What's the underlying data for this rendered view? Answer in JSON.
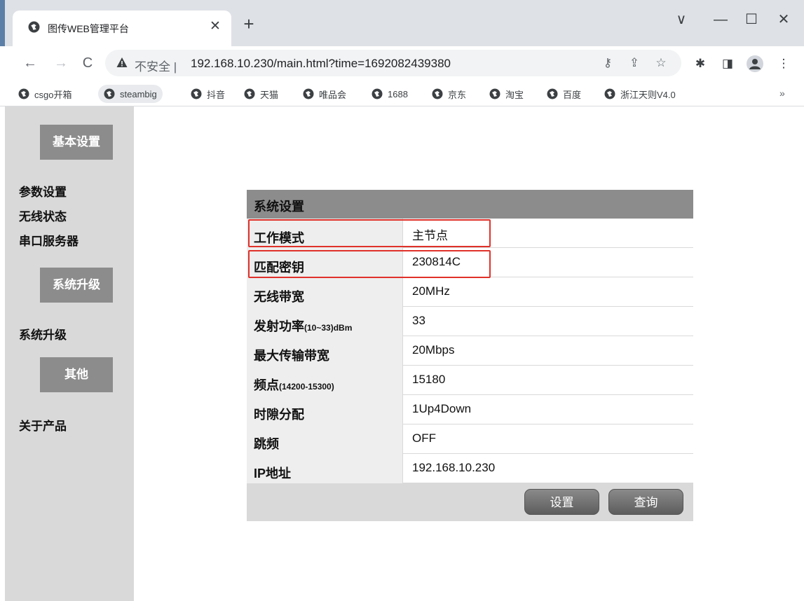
{
  "browser": {
    "tab_title": "图传WEB管理平台",
    "tab_close": "✕",
    "new_tab": "+",
    "window_minimize": "—",
    "window_maximize": "☐",
    "window_close": "✕",
    "window_menu": "∨",
    "back": "←",
    "forward": "→",
    "reload": "C",
    "insecure_label": "不安全 |",
    "url": "192.168.10.230/main.html?time=1692082439380",
    "bookmarks": [
      "csgo开箱",
      "steambig",
      "抖音",
      "天猫",
      "唯品会",
      "1688",
      "京东",
      "淘宝",
      "百度",
      "浙江天则V4.0"
    ],
    "bookmarks_more": "»",
    "icons": [
      "globe-icon",
      "key-icon",
      "share-icon",
      "star-icon",
      "extensions-icon",
      "side-panel-icon",
      "profile-icon",
      "menu-icon",
      "warning-icon"
    ]
  },
  "sidebar": {
    "sections": [
      {
        "title": "基本设置",
        "links": [
          "参数设置",
          "无线状态",
          "串口服务器"
        ]
      },
      {
        "title": "系统升级",
        "links": [
          "系统升级"
        ]
      },
      {
        "title": "其他",
        "links": [
          "关于产品"
        ]
      }
    ]
  },
  "panel": {
    "title": "系统设置",
    "rows": [
      {
        "label": "工作模式",
        "hint": "",
        "value": "主节点"
      },
      {
        "label": "匹配密钥",
        "hint": "",
        "value": "230814C"
      },
      {
        "label": "无线带宽",
        "hint": "",
        "value": "20MHz"
      },
      {
        "label": "发射功率",
        "hint": "(10~33)dBm",
        "value": "33"
      },
      {
        "label": "最大传输带宽",
        "hint": "",
        "value": "20Mbps"
      },
      {
        "label": "频点",
        "hint": "(14200-15300)",
        "value": "15180"
      },
      {
        "label": "时隙分配",
        "hint": "",
        "value": "1Up4Down"
      },
      {
        "label": "跳频",
        "hint": "",
        "value": "OFF"
      },
      {
        "label": "IP地址",
        "hint": "",
        "value": "192.168.10.230"
      }
    ],
    "buttons": {
      "set": "设置",
      "query": "查询"
    }
  },
  "colors": {
    "highlight": "#e0312a",
    "section_header": "#8c8c8c",
    "sidebar_bg": "#d9d9d9"
  }
}
